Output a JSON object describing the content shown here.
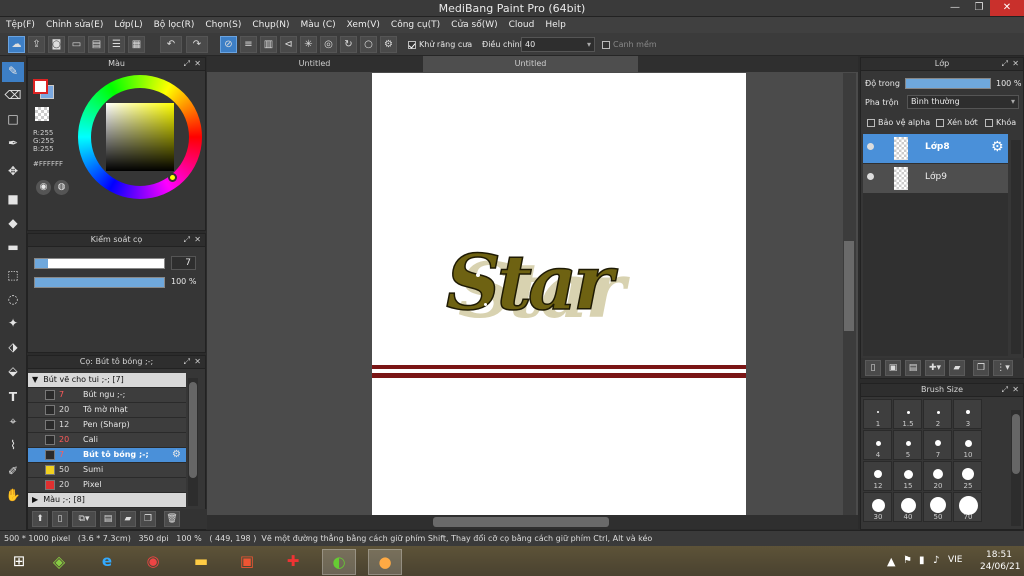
{
  "window": {
    "title": "MediBang Paint Pro (64bit)",
    "btn_min": "—",
    "btn_max": "❐",
    "btn_close": "✕"
  },
  "menu": [
    "Tệp(F)",
    "Chỉnh sửa(E)",
    "Lớp(L)",
    "Bộ lọc(R)",
    "Chọn(S)",
    "Chụp(N)",
    "Màu (C)",
    "Xem(V)",
    "Công cụ(T)",
    "Cửa số(W)",
    "Cloud",
    "Help"
  ],
  "toolbar": {
    "antialias_label": "Khử răng cưa",
    "correction_label": "Điều chỉnh",
    "correction_value": "40",
    "snap_label": "Canh mềm"
  },
  "color_panel": {
    "title": "Màu",
    "r": "R:255",
    "g": "G:255",
    "b": "B:255",
    "hex": "#FFFFFF",
    "primary": "#ffffff",
    "secondary": "#7aa8e0"
  },
  "brush_control": {
    "title": "Kiểm soát cọ",
    "size": "7",
    "opacity": "100 %",
    "size_fill": 0.1,
    "opacity_fill": 1.0
  },
  "brush_panel": {
    "title": "Cọ: Bút tô bóng ;-;",
    "group1": "Bút vẽ cho tui ;-; [7]",
    "items": [
      {
        "size": "7",
        "name": "Bút ngu ;-;",
        "color": "#2a2a2a",
        "size_red": true,
        "selected": false
      },
      {
        "size": "20",
        "name": "Tô mờ nhạt",
        "color": "#2a2a2a",
        "size_red": false,
        "selected": false
      },
      {
        "size": "12",
        "name": "Pen (Sharp)",
        "color": "#2a2a2a",
        "size_red": false,
        "selected": false
      },
      {
        "size": "20",
        "name": "Cali",
        "color": "#2a2a2a",
        "size_red": true,
        "selected": false
      },
      {
        "size": "7",
        "name": "Bút tô bóng ;-;",
        "color": "#2a2a2a",
        "size_red": true,
        "selected": true
      },
      {
        "size": "50",
        "name": "Sumi",
        "color": "#f0d020",
        "size_red": false,
        "selected": false
      },
      {
        "size": "20",
        "name": "Pixel",
        "color": "#e03030",
        "size_red": false,
        "selected": false
      }
    ],
    "group2": "Màu ;-; [8]"
  },
  "tabs": [
    "Untitled",
    "Untitled"
  ],
  "layers_panel": {
    "title": "Lớp",
    "opacity_label": "Độ trong",
    "opacity_value": "100 %",
    "blend_label": "Pha trộn",
    "blend_value": "Bình thường",
    "protect_alpha": "Bảo vệ alpha",
    "clipping": "Xén bớt",
    "lock": "Khóa",
    "layers": [
      {
        "name": "Lớp8",
        "selected": true
      },
      {
        "name": "Lớp9",
        "selected": false
      }
    ]
  },
  "brush_size_panel": {
    "title": "Brush Size",
    "sizes": [
      "1",
      "1.5",
      "2",
      "3",
      "4",
      "5",
      "7",
      "10",
      "12",
      "15",
      "20",
      "25",
      "30",
      "40",
      "50",
      "70"
    ]
  },
  "canvas_art": {
    "text": "Star"
  },
  "status": {
    "dims": "500 * 1000 pixel",
    "cm": "(3.6 * 7.3cm)",
    "dpi": "350 dpi",
    "zoom": "100 %",
    "coords": "( 449, 198 )",
    "hint": "Vẽ một đường thẳng bằng cách giữ phím Shift, Thay đổi cỡ cọ bằng cách giữ phím Ctrl, Alt và kéo"
  },
  "taskbar": {
    "lang": "VIE",
    "time": "18:51",
    "date": "24/06/21"
  }
}
